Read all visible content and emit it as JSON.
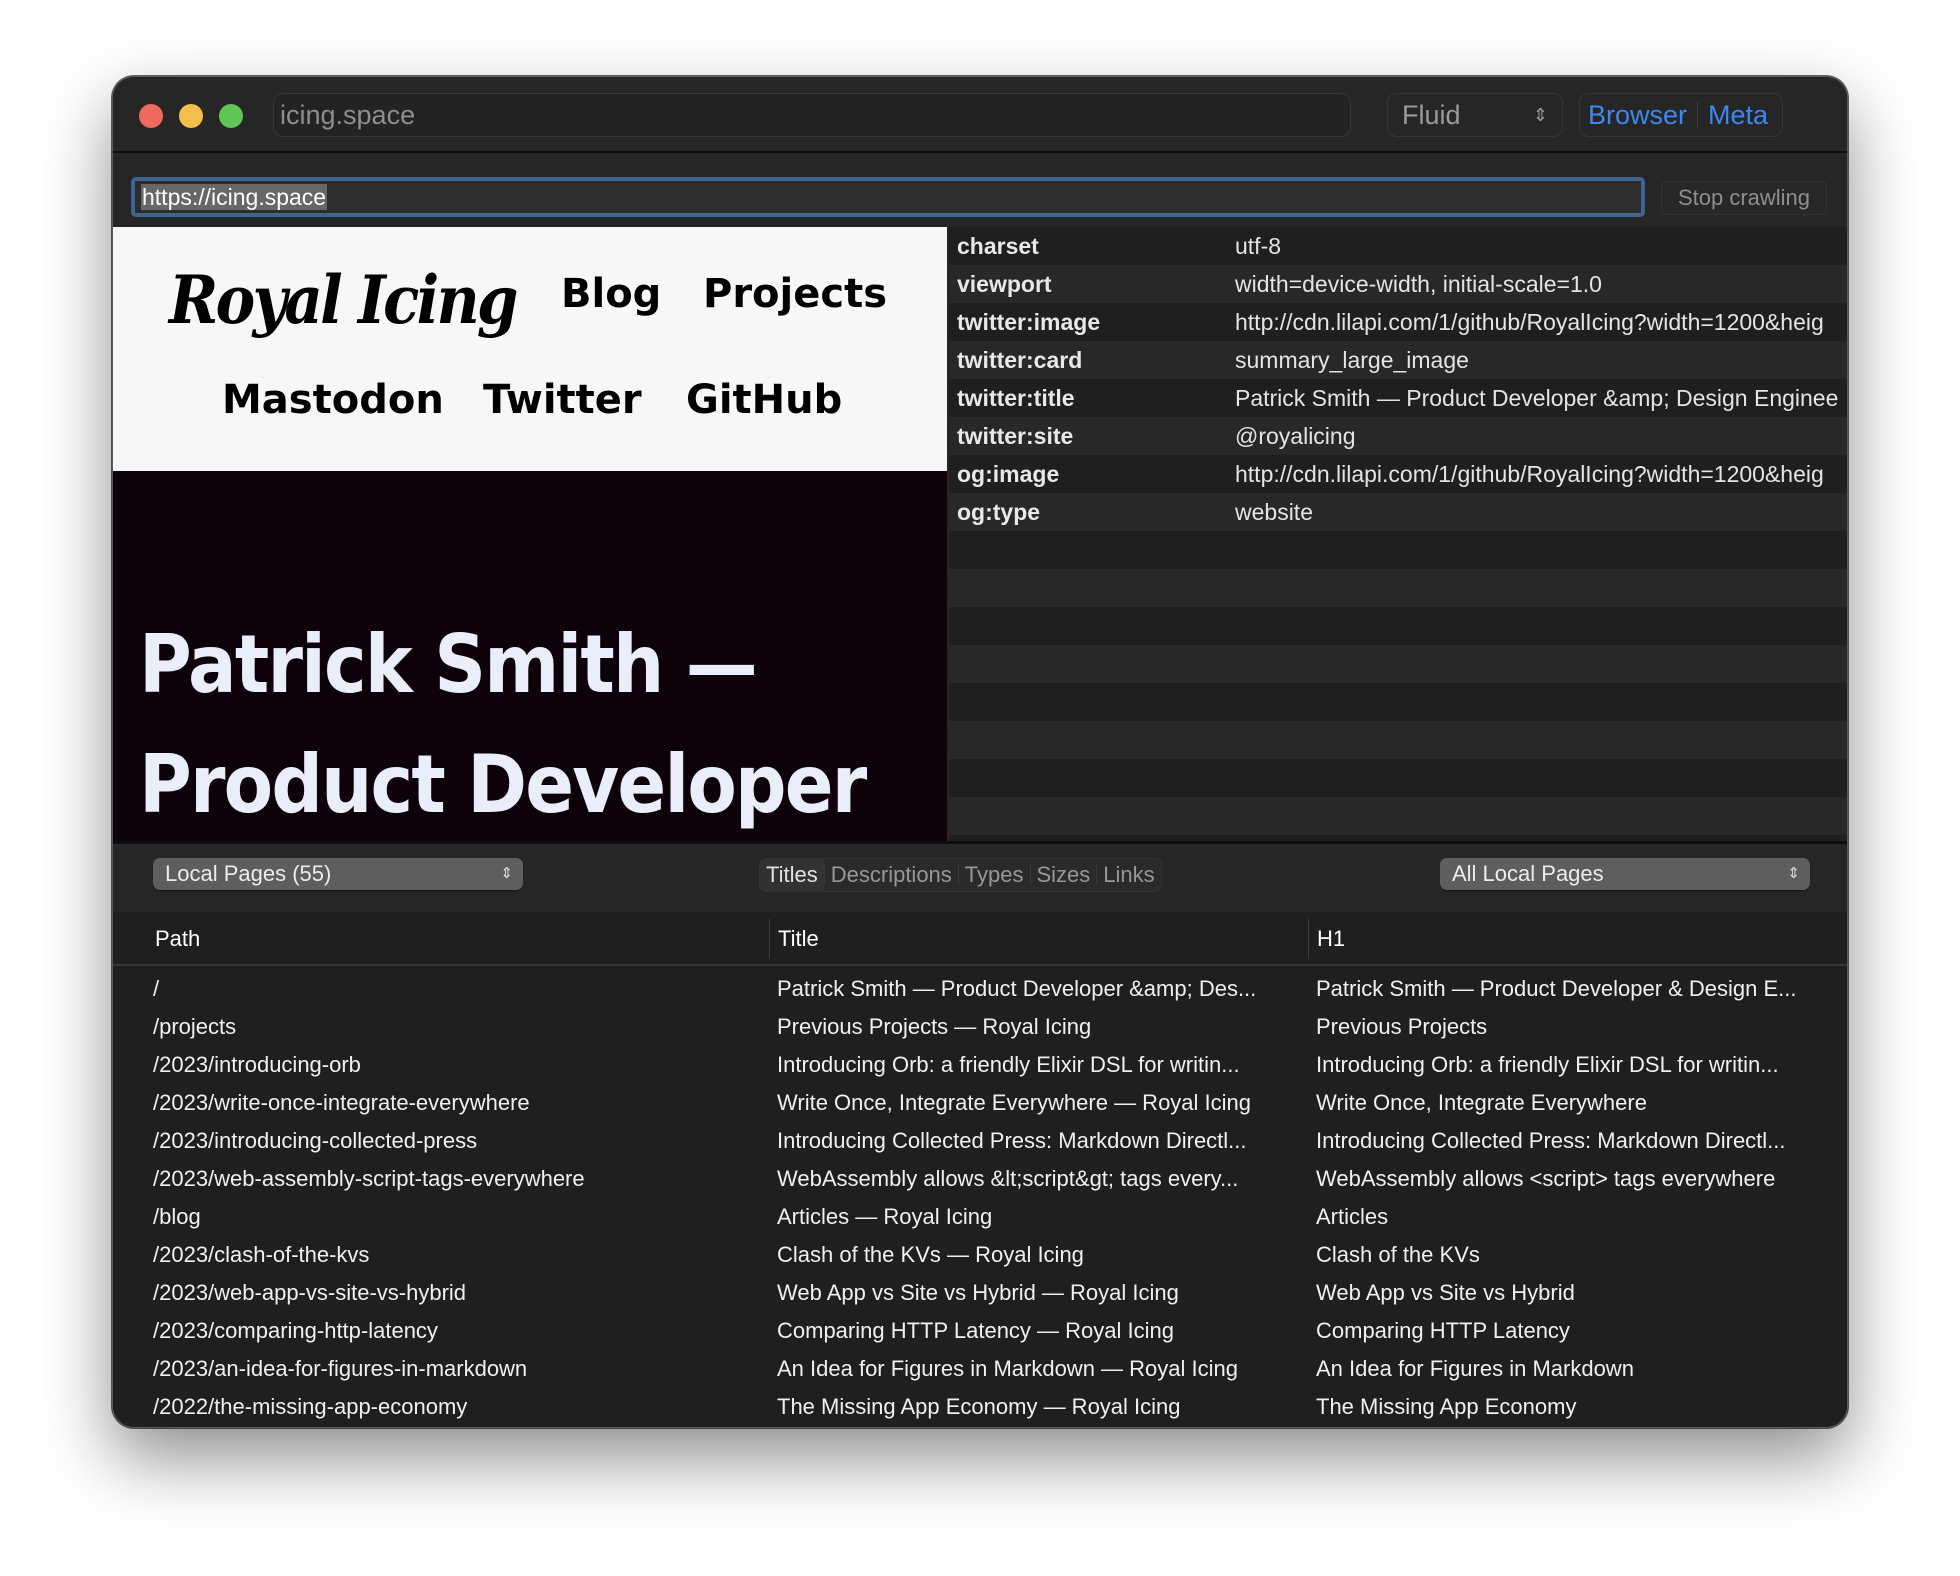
{
  "window": {
    "site_title": "icing.space",
    "layout_select": "Fluid",
    "view_segments": [
      "Browser",
      "Meta"
    ],
    "accent_color": "#3d87f1"
  },
  "url_bar": {
    "value": "https://icing.space",
    "stop_button": "Stop crawling"
  },
  "preview": {
    "logo": "Royal Icing",
    "nav": [
      "Blog",
      "Projects",
      "Mastodon",
      "Twitter",
      "GitHub"
    ],
    "hero_line1": "Patrick Smith —",
    "hero_line2": "Product Developer"
  },
  "meta": {
    "rows": [
      {
        "key": "charset",
        "value": "utf-8"
      },
      {
        "key": "viewport",
        "value": "width=device-width, initial-scale=1.0"
      },
      {
        "key": "twitter:image",
        "value": "http://cdn.lilapi.com/1/github/RoyalIcing?width=1200&heig"
      },
      {
        "key": "twitter:card",
        "value": "summary_large_image"
      },
      {
        "key": "twitter:title",
        "value": "Patrick Smith — Product Developer &amp; Design Enginee"
      },
      {
        "key": "twitter:site",
        "value": "@royalicing"
      },
      {
        "key": "og:image",
        "value": "http://cdn.lilapi.com/1/github/RoyalIcing?width=1200&heig"
      },
      {
        "key": "og:type",
        "value": "website"
      }
    ]
  },
  "lower_toolbar": {
    "pages_select": "Local Pages (55)",
    "tabs": [
      "Titles",
      "Descriptions",
      "Types",
      "Sizes",
      "Links"
    ],
    "active_tab": "Titles",
    "filter_select": "All Local Pages"
  },
  "table": {
    "columns": [
      "Path",
      "Title",
      "H1"
    ],
    "rows": [
      {
        "path": "/",
        "title": "Patrick Smith — Product Developer &amp; Des...",
        "h1": "Patrick Smith — Product Developer & Design E..."
      },
      {
        "path": "/projects",
        "title": "Previous Projects — Royal Icing",
        "h1": "Previous Projects"
      },
      {
        "path": "/2023/introducing-orb",
        "title": "Introducing Orb: a friendly Elixir DSL for writin...",
        "h1": "Introducing Orb: a friendly Elixir DSL for writin..."
      },
      {
        "path": "/2023/write-once-integrate-everywhere",
        "title": "Write Once, Integrate Everywhere — Royal Icing",
        "h1": "Write Once, Integrate Everywhere"
      },
      {
        "path": "/2023/introducing-collected-press",
        "title": "Introducing Collected Press: Markdown Directl...",
        "h1": "Introducing Collected Press: Markdown Directl..."
      },
      {
        "path": "/2023/web-assembly-script-tags-everywhere",
        "title": "WebAssembly allows &lt;script&gt; tags every...",
        "h1": "WebAssembly allows <script> tags everywhere"
      },
      {
        "path": "/blog",
        "title": "Articles — Royal Icing",
        "h1": "Articles"
      },
      {
        "path": "/2023/clash-of-the-kvs",
        "title": "Clash of the KVs — Royal Icing",
        "h1": "Clash of the KVs"
      },
      {
        "path": "/2023/web-app-vs-site-vs-hybrid",
        "title": "Web App vs Site vs Hybrid — Royal Icing",
        "h1": "Web App vs Site vs Hybrid"
      },
      {
        "path": "/2023/comparing-http-latency",
        "title": "Comparing HTTP Latency — Royal Icing",
        "h1": "Comparing HTTP Latency"
      },
      {
        "path": "/2023/an-idea-for-figures-in-markdown",
        "title": "An Idea for Figures in Markdown — Royal Icing",
        "h1": "An Idea for Figures in Markdown"
      },
      {
        "path": "/2022/the-missing-app-economy",
        "title": "The Missing App Economy — Royal Icing",
        "h1": "The Missing App Economy"
      }
    ]
  }
}
